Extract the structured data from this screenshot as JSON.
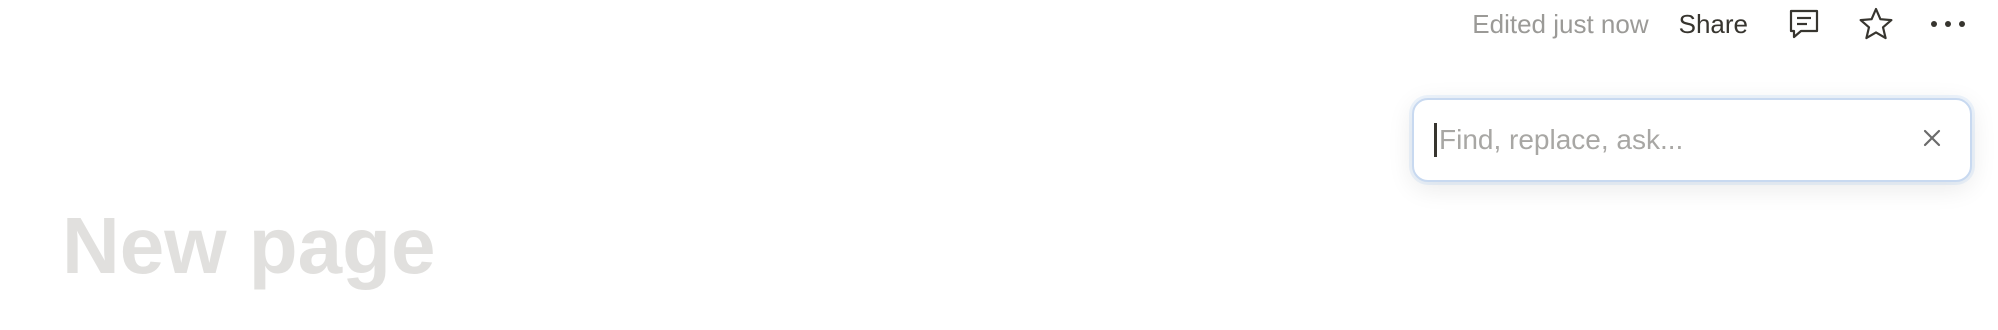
{
  "header": {
    "edited_status": "Edited just now",
    "share_label": "Share",
    "icons": {
      "comment": "comment-icon",
      "favorite": "star-icon",
      "more": "more-horizontal-icon"
    }
  },
  "find": {
    "placeholder": "Find, replace, ask...",
    "value": "",
    "clear_icon": "close-icon"
  },
  "page": {
    "title_placeholder": "New page"
  },
  "colors": {
    "text_primary": "#37352f",
    "text_muted": "#9b9a97",
    "title_placeholder": "#e1e0de",
    "focus_ring": "#c8d9f0"
  }
}
